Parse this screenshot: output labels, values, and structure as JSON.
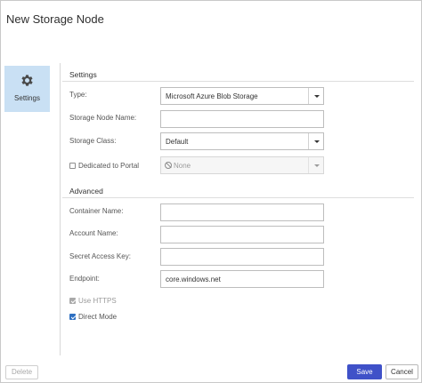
{
  "dialog": {
    "title": "New Storage Node"
  },
  "nav": {
    "items": [
      {
        "label": "Settings",
        "icon": "gear-icon",
        "selected": true
      }
    ]
  },
  "settings": {
    "heading": "Settings",
    "type": {
      "label": "Type:",
      "value": "Microsoft Azure Blob Storage"
    },
    "storage_node_name": {
      "label": "Storage Node Name:",
      "value": ""
    },
    "storage_class": {
      "label": "Storage Class:",
      "value": "Default"
    },
    "dedicated_to_portal": {
      "label": "Dedicated to Portal",
      "checked": false,
      "value": "None",
      "icon": "none-icon"
    }
  },
  "advanced": {
    "heading": "Advanced",
    "container_name": {
      "label": "Container Name:",
      "value": ""
    },
    "account_name": {
      "label": "Account Name:",
      "value": ""
    },
    "secret_access_key": {
      "label": "Secret Access Key:",
      "value": ""
    },
    "endpoint": {
      "label": "Endpoint:",
      "value": "core.windows.net"
    },
    "use_https": {
      "label": "Use HTTPS",
      "checked": true,
      "disabled": true
    },
    "direct_mode": {
      "label": "Direct Mode",
      "checked": true
    }
  },
  "footer": {
    "delete_label": "Delete",
    "save_label": "Save",
    "cancel_label": "Cancel"
  },
  "colors": {
    "accent": "#3f51c8",
    "nav_selected": "#c9e0f4",
    "checkbox": "#2d6fc1"
  }
}
